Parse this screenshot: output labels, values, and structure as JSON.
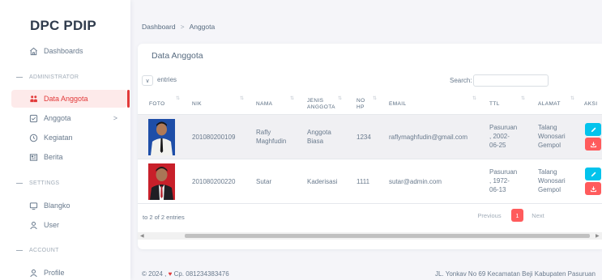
{
  "sidebar": {
    "brand": "DPC PDIP",
    "dashboards": "Dashboards",
    "sections": {
      "administrator": "ADMINISTRATOR",
      "settings": "SETTINGS",
      "account": "ACCOUNT"
    },
    "items": {
      "data_anggota": "Data Anggota",
      "anggota": "Anggota",
      "kegiatan": "Kegiatan",
      "berita": "Berita",
      "blangko": "Blangko",
      "user": "User",
      "profile": "Profile"
    },
    "chevron": ">"
  },
  "breadcrumb": {
    "home": "Dashboard",
    "sep": ">",
    "current": "Anggota"
  },
  "card": {
    "title": "Data Anggota",
    "length_value": "∨",
    "length_label": "entries",
    "search_label": "Search:"
  },
  "table": {
    "headers": {
      "foto": "FOTO",
      "nik": "NIK",
      "nama": "NAMA",
      "jenis_1": "JENIS",
      "jenis_2": "ANGGOTA",
      "nohp_1": "NO",
      "nohp_2": "HP",
      "email": "EMAIL",
      "ttl": "TTL",
      "alamat": "ALAMAT",
      "aksi": "AKSI"
    },
    "rows": [
      {
        "nik": "201080200109",
        "nama_1": "Rafly",
        "nama_2": "Maghfudin",
        "jenis_1": "Anggota",
        "jenis_2": "Biasa",
        "nohp": "1234",
        "email": "raflymaghfudin@gmail.com",
        "ttl_1": "Pasuruan",
        "ttl_2": ", 2002-",
        "ttl_3": "06-25",
        "alamat_1": "Talang",
        "alamat_2": "Wonosari",
        "alamat_3": "Gempol"
      },
      {
        "nik": "201080200220",
        "nama_1": "Sutar",
        "nama_2": "",
        "jenis_1": "Kaderisasi",
        "jenis_2": "",
        "nohp": "1111",
        "email": "sutar@admin.com",
        "ttl_1": "Pasuruan",
        "ttl_2": ", 1972-",
        "ttl_3": "06-13",
        "alamat_1": "Talang",
        "alamat_2": "Wonosari",
        "alamat_3": "Gempol"
      }
    ],
    "info": "to 2 of 2 entries",
    "pagination": {
      "prev": "Previous",
      "page": "1",
      "next": "Next"
    }
  },
  "footer": {
    "left_pre": "© 2024 ,",
    "left_post": "Cp. 081234383476",
    "right": "JL. Yonkav No 69 Kecamatan Beji Kabupaten Pasuruan"
  },
  "colors": {
    "accent": "#e23a3a",
    "edit": "#03c3ec",
    "download": "#ff5b5c"
  }
}
